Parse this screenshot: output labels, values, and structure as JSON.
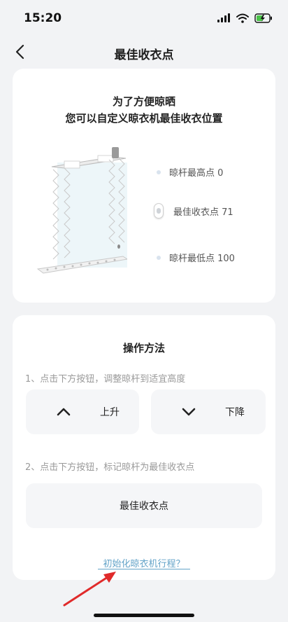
{
  "status": {
    "time": "15:20"
  },
  "nav": {
    "title": "最佳收衣点"
  },
  "intro": {
    "line1": "为了方便晾晒",
    "line2": "您可以自定义晾衣机最佳收衣位置"
  },
  "legend": {
    "highest": "晾杆最高点 0",
    "best": "最佳收衣点 71",
    "lowest": "晾杆最低点 100"
  },
  "guide": {
    "title": "操作方法",
    "step1": "1、点击下方按钮，调整晾杆到适宜高度",
    "step2": "2、点击下方按钮，标记晾杆为最佳收衣点",
    "up_label": "上升",
    "down_label": "下降",
    "best_button_label": "最佳收衣点",
    "init_link": "初始化晾衣机行程？"
  },
  "best_point_level": 0.71,
  "colors": {
    "link": "#63a3c8",
    "annotation_arrow": "#e02a2a",
    "battery": "#49c247"
  },
  "icons": [
    "chevron-left-icon",
    "signal-icon",
    "wifi-icon",
    "battery-charging-icon",
    "chevron-up-icon",
    "chevron-down-icon"
  ]
}
